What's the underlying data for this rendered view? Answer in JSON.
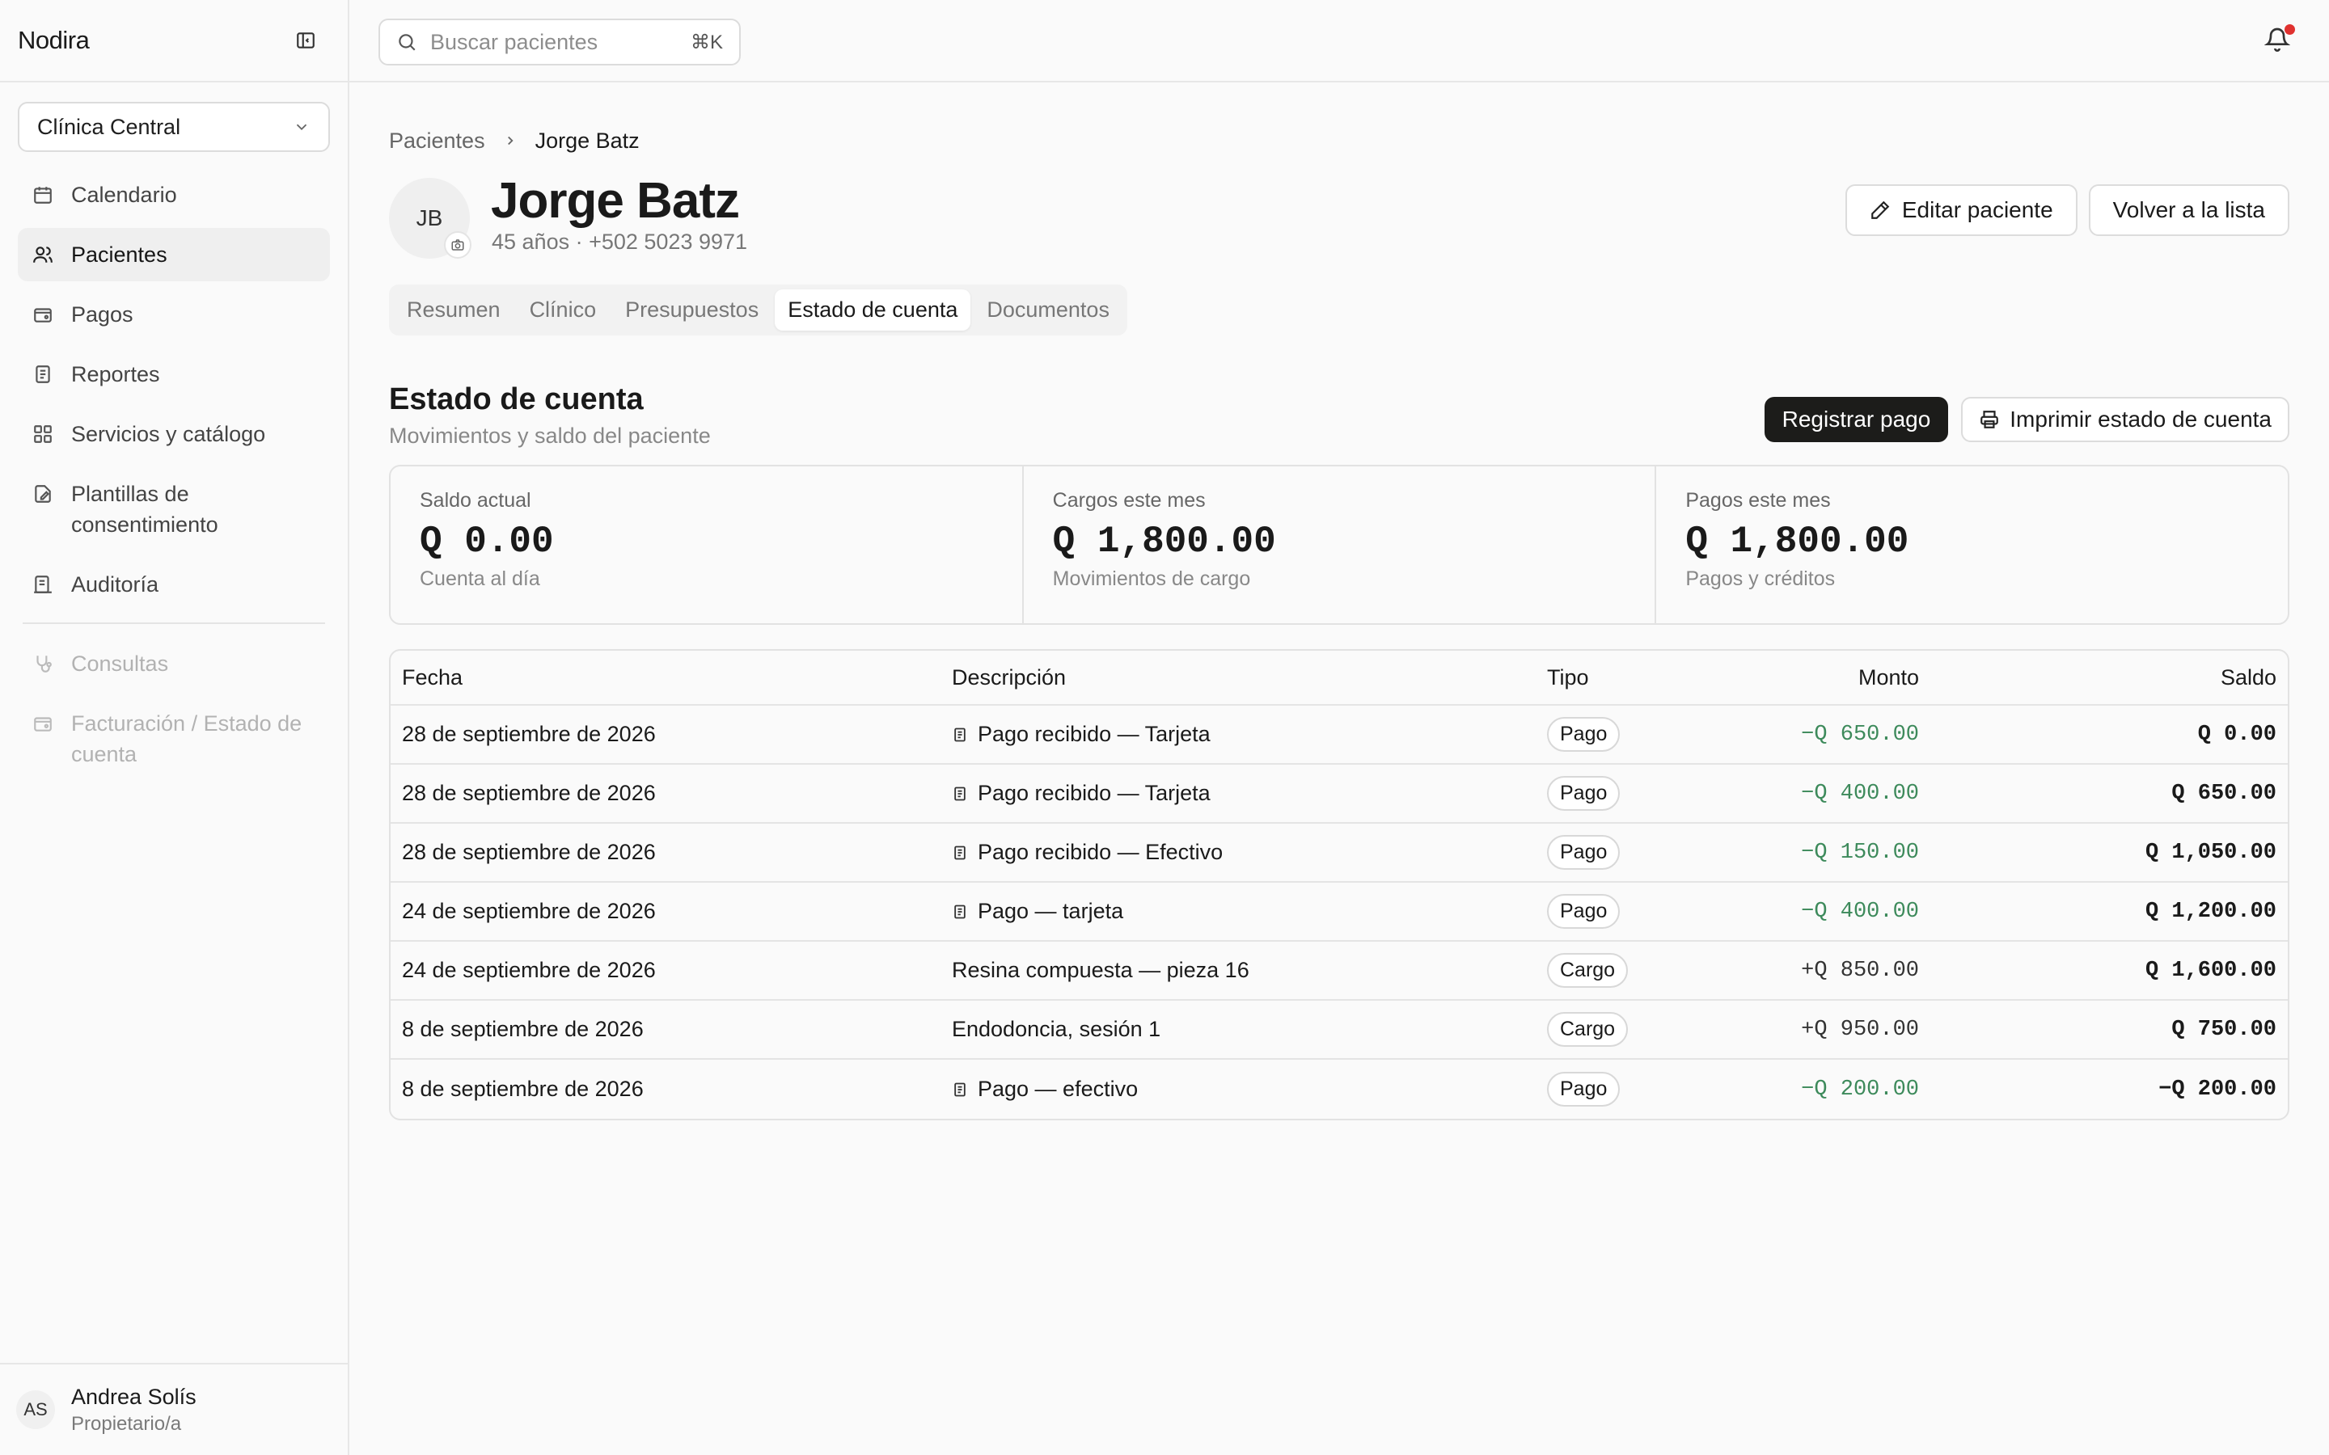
{
  "app": {
    "brand": "Nodira"
  },
  "sidebar": {
    "clinic": "Clínica Central",
    "items": [
      {
        "label": "Calendario",
        "icon": "calendar-icon",
        "state": "normal"
      },
      {
        "label": "Pacientes",
        "icon": "users-icon",
        "state": "active"
      },
      {
        "label": "Pagos",
        "icon": "wallet-icon",
        "state": "normal"
      },
      {
        "label": "Reportes",
        "icon": "receipt-icon",
        "state": "normal"
      },
      {
        "label": "Servicios y catálogo",
        "icon": "grid-icon",
        "state": "normal"
      },
      {
        "label": "Plantillas de consentimiento",
        "icon": "file-edit-icon",
        "state": "normal"
      },
      {
        "label": "Auditoría",
        "icon": "audit-icon",
        "state": "normal"
      }
    ],
    "disabled_items": [
      {
        "label": "Consultas",
        "icon": "stethoscope-icon"
      },
      {
        "label": "Facturación / Estado de cuenta",
        "icon": "wallet-icon"
      }
    ],
    "user": {
      "initials": "AS",
      "name": "Andrea Solís",
      "role": "Propietario/a"
    }
  },
  "topbar": {
    "search_placeholder": "Buscar pacientes",
    "search_shortcut": "⌘K",
    "has_notification": true
  },
  "breadcrumb": {
    "parent": "Pacientes",
    "current": "Jorge Batz"
  },
  "patient": {
    "initials": "JB",
    "name": "Jorge Batz",
    "meta": "45 años · +502 5023 9971",
    "edit_label": "Editar paciente",
    "back_label": "Volver a la lista"
  },
  "tabs": [
    {
      "label": "Resumen",
      "active": false
    },
    {
      "label": "Clínico",
      "active": false
    },
    {
      "label": "Presupuestos",
      "active": false
    },
    {
      "label": "Estado de cuenta",
      "active": true
    },
    {
      "label": "Documentos",
      "active": false
    }
  ],
  "statement": {
    "title": "Estado de cuenta",
    "subtitle": "Movimientos y saldo del paciente",
    "register_label": "Registrar pago",
    "print_label": "Imprimir estado de cuenta",
    "stats": [
      {
        "label": "Saldo actual",
        "value": "Q 0.00",
        "sub": "Cuenta al día"
      },
      {
        "label": "Cargos este mes",
        "value": "Q 1,800.00",
        "sub": "Movimientos de cargo"
      },
      {
        "label": "Pagos este mes",
        "value": "Q 1,800.00",
        "sub": "Pagos y créditos"
      }
    ],
    "columns": {
      "fecha": "Fecha",
      "descripcion": "Descripción",
      "tipo": "Tipo",
      "monto": "Monto",
      "saldo": "Saldo"
    },
    "rows": [
      {
        "fecha": "28 de septiembre de 2026",
        "descripcion": "Pago recibido — Tarjeta",
        "receipt": true,
        "tipo": "Pago",
        "monto": "−Q 650.00",
        "saldo": "Q 0.00"
      },
      {
        "fecha": "28 de septiembre de 2026",
        "descripcion": "Pago recibido — Tarjeta",
        "receipt": true,
        "tipo": "Pago",
        "monto": "−Q 400.00",
        "saldo": "Q 650.00"
      },
      {
        "fecha": "28 de septiembre de 2026",
        "descripcion": "Pago recibido — Efectivo",
        "receipt": true,
        "tipo": "Pago",
        "monto": "−Q 150.00",
        "saldo": "Q 1,050.00"
      },
      {
        "fecha": "24 de septiembre de 2026",
        "descripcion": "Pago — tarjeta",
        "receipt": true,
        "tipo": "Pago",
        "monto": "−Q 400.00",
        "saldo": "Q 1,200.00"
      },
      {
        "fecha": "24 de septiembre de 2026",
        "descripcion": "Resina compuesta — pieza 16",
        "receipt": false,
        "tipo": "Cargo",
        "monto": "+Q 850.00",
        "saldo": "Q 1,600.00"
      },
      {
        "fecha": "8 de septiembre de 2026",
        "descripcion": "Endodoncia, sesión 1",
        "receipt": false,
        "tipo": "Cargo",
        "monto": "+Q 950.00",
        "saldo": "Q 750.00"
      },
      {
        "fecha": "8 de septiembre de 2026",
        "descripcion": "Pago — efectivo",
        "receipt": true,
        "tipo": "Pago",
        "monto": "−Q 200.00",
        "saldo": "−Q 200.00"
      }
    ]
  },
  "colors": {
    "payment_green": "#3d8a5b",
    "notification_red": "#e0312f",
    "primary_dark": "#1c1c1a"
  }
}
